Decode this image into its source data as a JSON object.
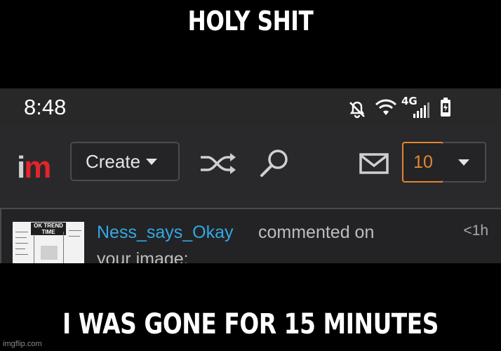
{
  "meme": {
    "top_caption": "HOLY SHIT",
    "bottom_caption": "I WAS GONE FOR 15 MINUTES",
    "watermark": "imgflip.com"
  },
  "status_bar": {
    "time": "8:48",
    "network_label": "4G",
    "icons": [
      "bell-muted-icon",
      "wifi-icon",
      "signal-icon",
      "battery-icon"
    ]
  },
  "top_nav": {
    "logo_i": "i",
    "logo_m": "m",
    "create_label": "Create",
    "icons": [
      "shuffle-icon",
      "search-icon",
      "mail-icon",
      "chevron-down-icon"
    ],
    "notification_count": "10"
  },
  "notification": {
    "thumb_title": "OK TREND TIME",
    "username": "Ness_says_Okay",
    "action": "commented on",
    "line2": "your image:",
    "time": "<1h"
  },
  "colors": {
    "background": "#000000",
    "header": "#29292b",
    "accent_red": "#e2242b",
    "notification_orange": "#e3862f",
    "username_blue": "#33a9e0"
  }
}
